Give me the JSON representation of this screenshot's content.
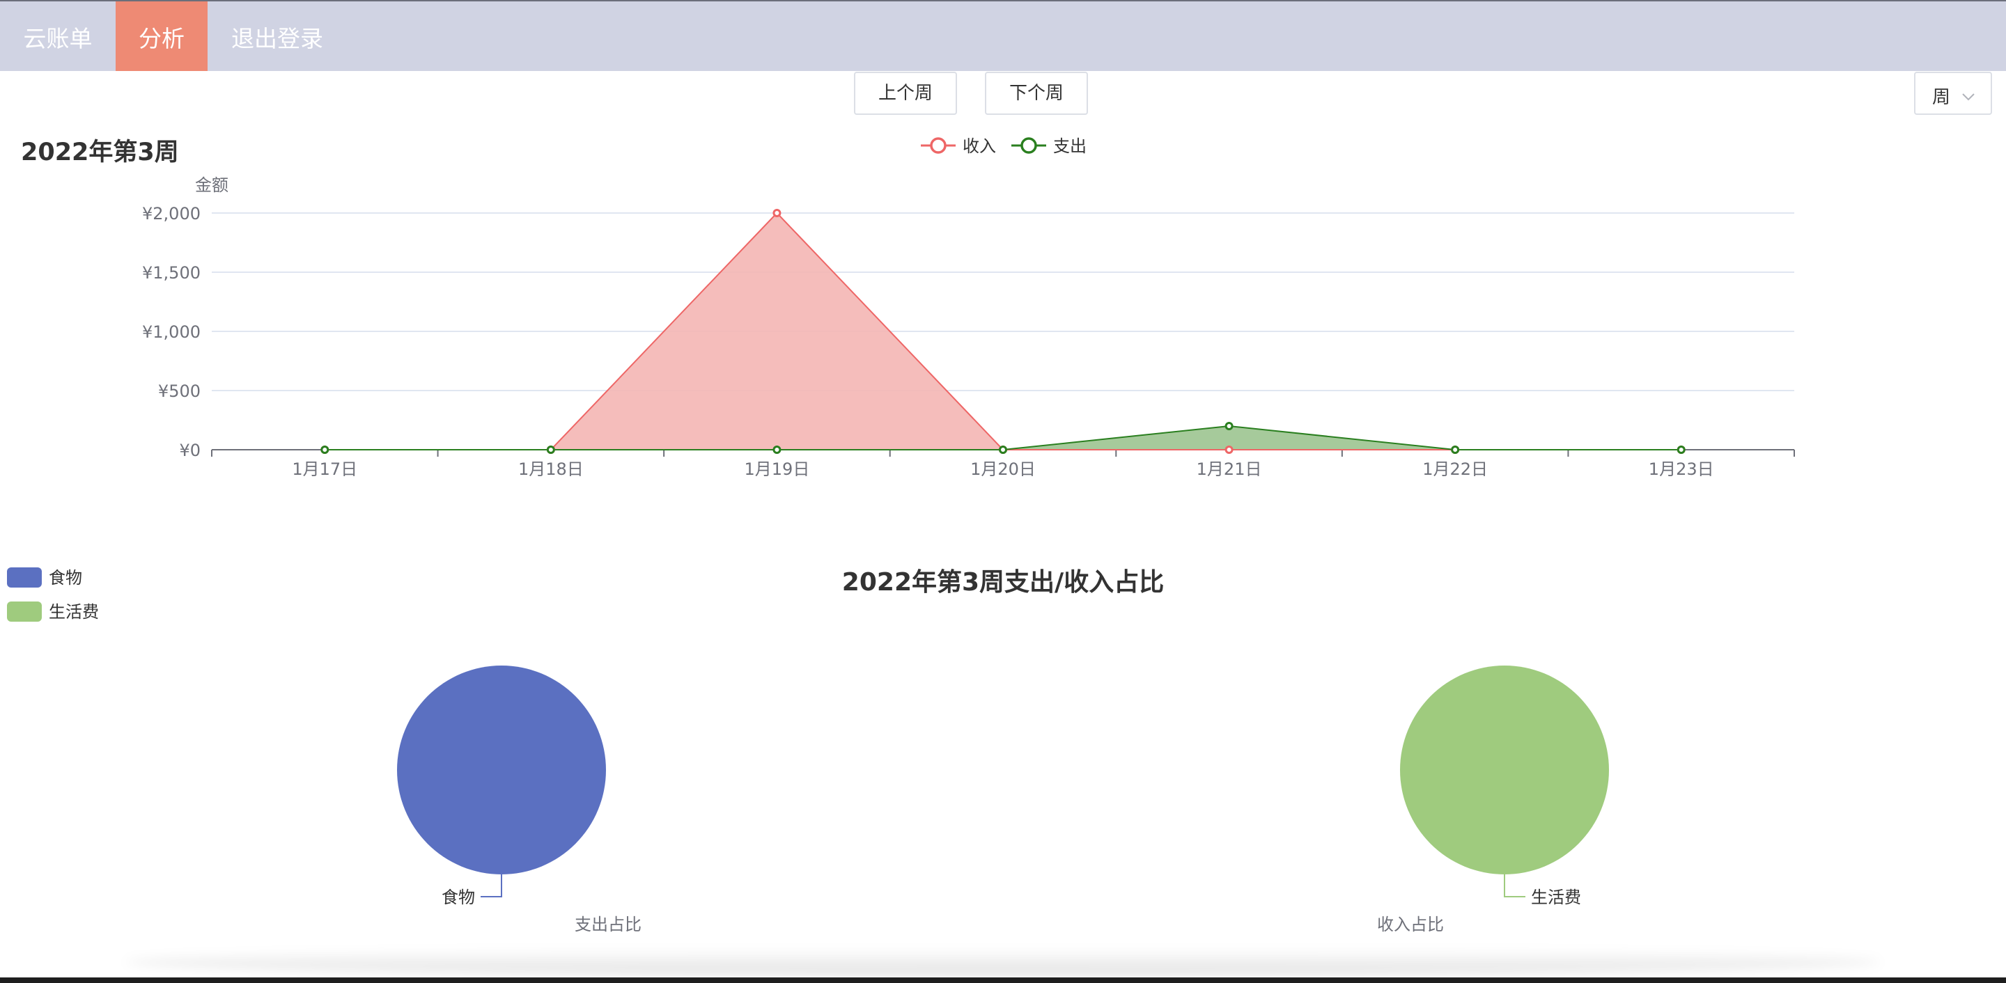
{
  "nav": {
    "items": [
      {
        "label": "云账单",
        "active": false
      },
      {
        "label": "分析",
        "active": true
      },
      {
        "label": "退出登录",
        "active": false
      }
    ],
    "active_color": "#ee8a74",
    "bar_color": "#d0d3e3"
  },
  "controls": {
    "prev_label": "上个周",
    "next_label": "下个周",
    "period_select": "周",
    "period_icon": "chevron-down-icon"
  },
  "chart_data": [
    {
      "type": "area",
      "title": "2022年第3周",
      "ylabel": "金额",
      "xlabel": "",
      "categories": [
        "1月17日",
        "1月18日",
        "1月19日",
        "1月20日",
        "1月21日",
        "1月22日",
        "1月23日"
      ],
      "ylim": [
        0,
        2000
      ],
      "yticks": [
        0,
        500,
        1000,
        1500,
        2000
      ],
      "ytick_labels": [
        "¥0",
        "¥500",
        "¥1,000",
        "¥1,500",
        "¥2,000"
      ],
      "grid": true,
      "legend_position": "top-center",
      "series": [
        {
          "name": "收入",
          "color": "#ee6666",
          "fill": "#f4b6b4",
          "values": [
            0,
            0,
            2000,
            0,
            0,
            0,
            0
          ]
        },
        {
          "name": "支出",
          "color": "#2a7f1f",
          "fill": "#9cc490",
          "values": [
            0,
            0,
            0,
            0,
            200,
            0,
            0
          ]
        }
      ]
    },
    {
      "type": "pie",
      "title": "2022年第3周支出/收入占比",
      "legend_position": "top-left",
      "legend": [
        {
          "name": "食物",
          "color": "#5b70c1"
        },
        {
          "name": "生活费",
          "color": "#9fcb7e"
        }
      ],
      "pies": [
        {
          "caption": "支出占比",
          "slices": [
            {
              "name": "食物",
              "percent": 100,
              "color": "#5b70c1"
            }
          ]
        },
        {
          "caption": "收入占比",
          "slices": [
            {
              "name": "生活费",
              "percent": 100,
              "color": "#9fcb7e"
            }
          ]
        }
      ]
    }
  ]
}
